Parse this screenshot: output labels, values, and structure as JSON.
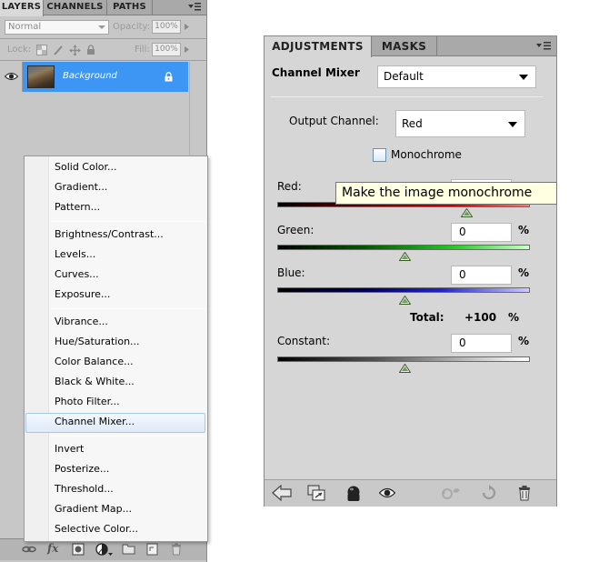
{
  "layers": {
    "tabs": [
      "LAYERS",
      "CHANNELS",
      "PATHS"
    ],
    "blend_mode": "Normal",
    "opacity_label": "Opacity:",
    "opacity_value": "100%",
    "lock_label": "Lock:",
    "fill_label": "Fill:",
    "fill_value": "100%",
    "layer_name": "Background"
  },
  "menu": {
    "items": [
      "Solid Color...",
      "Gradient...",
      "Pattern...",
      "Brightness/Contrast...",
      "Levels...",
      "Curves...",
      "Exposure...",
      "Vibrance...",
      "Hue/Saturation...",
      "Color Balance...",
      "Black & White...",
      "Photo Filter...",
      "Channel Mixer...",
      "Invert",
      "Posterize...",
      "Threshold...",
      "Gradient Map...",
      "Selective Color..."
    ],
    "selected": "Channel Mixer..."
  },
  "adjustments": {
    "tabs": [
      "ADJUSTMENTS",
      "MASKS"
    ],
    "title": "Channel Mixer",
    "preset": "Default",
    "output_channel_label": "Output Channel:",
    "output_channel": "Red",
    "monochrome_label": "Monochrome",
    "monochrome_checked": false,
    "sliders": {
      "red": {
        "label": "Red:",
        "value": 100
      },
      "green": {
        "label": "Green:",
        "value": "0",
        "pct": "%"
      },
      "blue": {
        "label": "Blue:",
        "value": "0",
        "pct": "%"
      },
      "constant": {
        "label": "Constant:",
        "value": "0",
        "pct": "%"
      }
    },
    "total_label": "Total:",
    "total_value": "+100",
    "total_pct": "%",
    "tooltip": "Make the image monochrome"
  },
  "colors": {
    "selection_blue": "#3d95f4",
    "red_track": "#cc0000",
    "green_track": "#22cc22",
    "blue_track": "#2222cc"
  }
}
